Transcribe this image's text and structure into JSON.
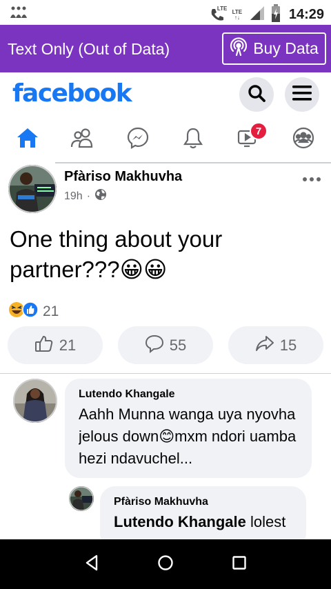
{
  "status_bar": {
    "time": "14:29",
    "network_1": "LTE",
    "network_2": "LTE",
    "icons": [
      "app-icon",
      "wifi-call-icon",
      "signal-icon",
      "battery-icon"
    ]
  },
  "banner": {
    "text": "Text Only (Out of Data)",
    "buy_label": "Buy Data",
    "color": "#7b34c0"
  },
  "header": {
    "logo": "facebook",
    "logo_color": "#1877f2"
  },
  "nav": {
    "items": [
      {
        "name": "home",
        "icon": "home-icon",
        "active": true
      },
      {
        "name": "friends",
        "icon": "friends-icon"
      },
      {
        "name": "messenger",
        "icon": "messenger-icon"
      },
      {
        "name": "notifications",
        "icon": "bell-icon"
      },
      {
        "name": "watch",
        "icon": "video-icon",
        "badge": "7"
      },
      {
        "name": "groups",
        "icon": "groups-icon"
      }
    ]
  },
  "post": {
    "author": "Pfàriso Makhuvha",
    "time": "19h",
    "dot": "·",
    "text": "One thing about your partner???😀😀",
    "reaction_count": "21",
    "like_count": "21",
    "comment_count": "55",
    "share_count": "15"
  },
  "comments": [
    {
      "author": "Lutendo Khangale",
      "text": "Aahh Munna wanga uya nyovha jelous down😊mxm ndori uamba hezi ndavuchel..."
    },
    {
      "author": "Pfàriso Makhuvha",
      "mention": "Lutendo Khangale",
      "text": " lolest"
    }
  ]
}
